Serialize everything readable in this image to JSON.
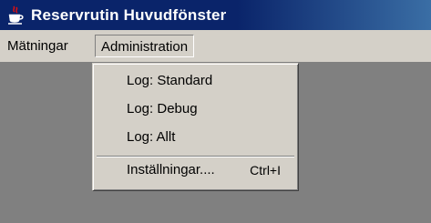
{
  "window": {
    "title": "Reservrutin Huvudfönster",
    "icon": "java-cup-icon"
  },
  "menubar": {
    "items": [
      {
        "label": "Mätningar"
      },
      {
        "label": "Administration"
      }
    ]
  },
  "dropdown": {
    "items": [
      {
        "label": "Log: Standard"
      },
      {
        "label": "Log: Debug"
      },
      {
        "label": "Log: Allt"
      },
      {
        "label": "Inställningar....",
        "shortcut": "Ctrl+I"
      }
    ]
  },
  "colors": {
    "titlebar": "#0a246a",
    "menu_bg": "#d4d0c8",
    "client_bg": "#808080"
  }
}
